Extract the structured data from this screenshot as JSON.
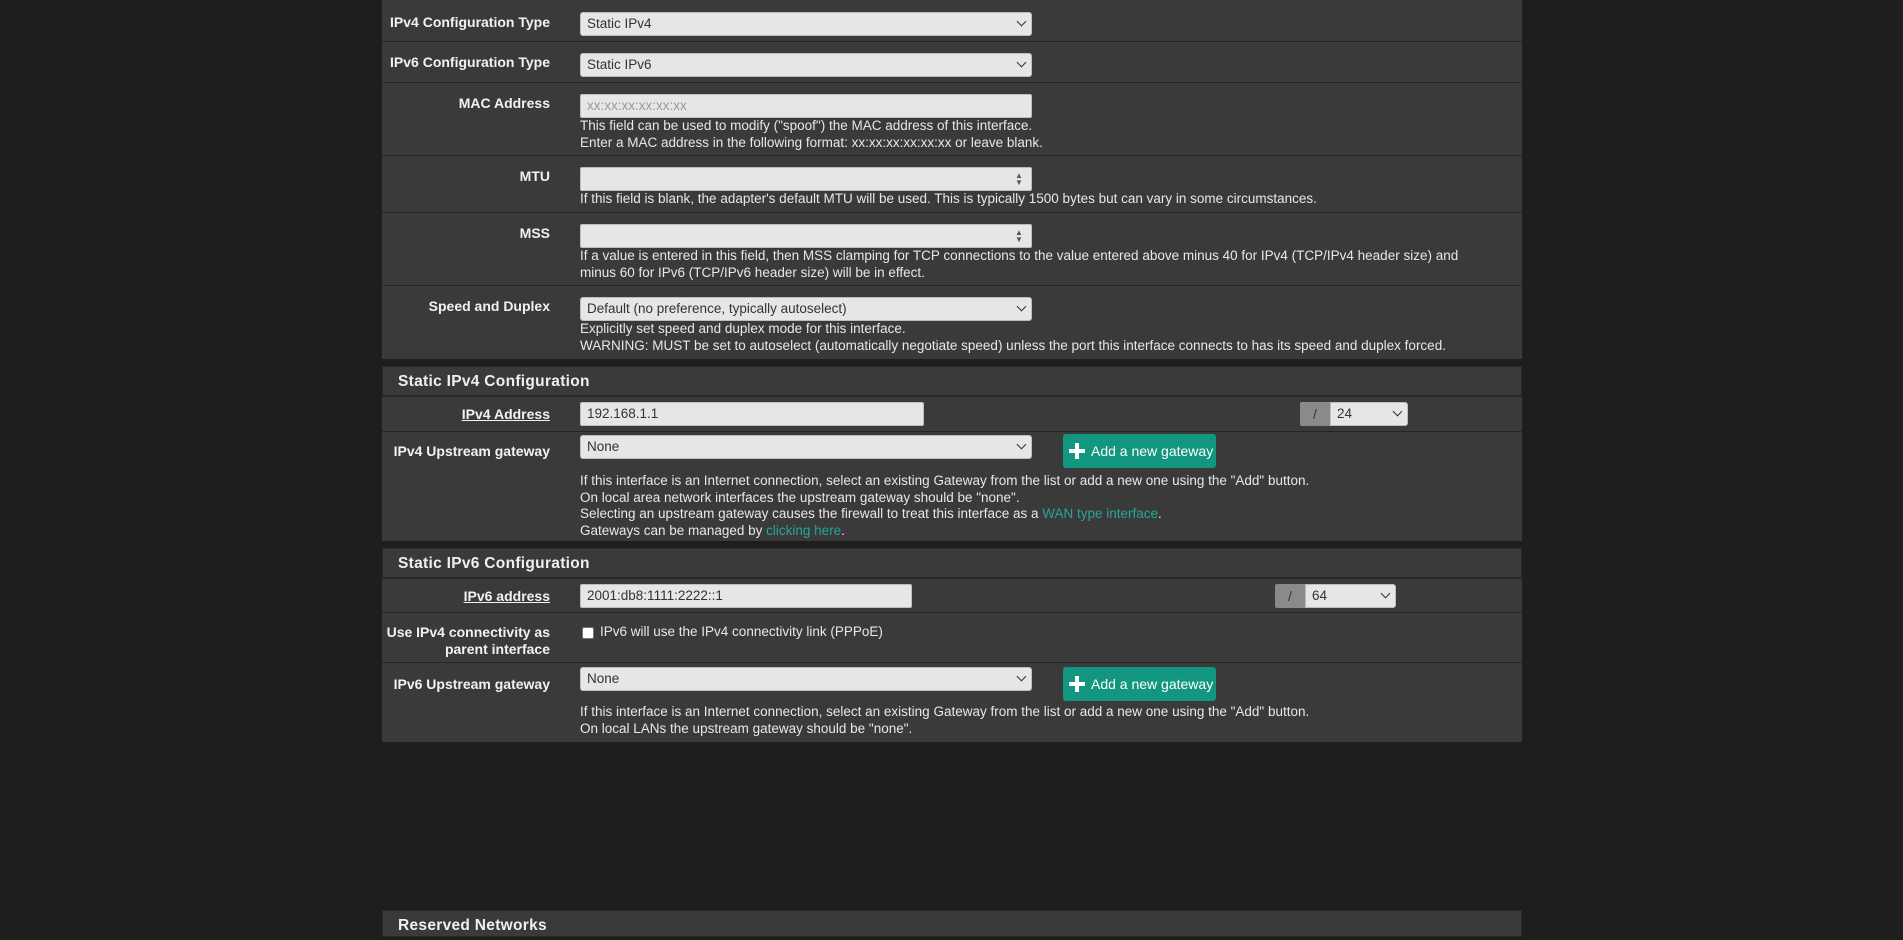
{
  "general": {
    "ipv4_type": {
      "label": "IPv4 Configuration Type",
      "value": "Static IPv4"
    },
    "ipv6_type": {
      "label": "IPv6 Configuration Type",
      "value": "Static IPv6"
    },
    "mac": {
      "label": "MAC Address",
      "placeholder": "xx:xx:xx:xx:xx:xx",
      "help1": "This field can be used to modify (\"spoof\") the MAC address of this interface.",
      "help2": "Enter a MAC address in the following format: xx:xx:xx:xx:xx:xx or leave blank."
    },
    "mtu": {
      "label": "MTU",
      "help1": "If this field is blank, the adapter's default MTU will be used. This is typically 1500 bytes but can vary in some circumstances."
    },
    "mss": {
      "label": "MSS",
      "help1": "If a value is entered in this field, then MSS clamping for TCP connections to the value entered above minus 40 for IPv4 (TCP/IPv4 header size) and",
      "help2": "minus 60 for IPv6 (TCP/IPv6 header size) will be in effect."
    },
    "speed": {
      "label": "Speed and Duplex",
      "value": "Default (no preference, typically autoselect)",
      "help1": "Explicitly set speed and duplex mode for this interface.",
      "help2": "WARNING: MUST be set to autoselect (automatically negotiate speed) unless the port this interface connects to has its speed and duplex forced."
    }
  },
  "static_ipv4": {
    "title": "Static IPv4 Configuration",
    "address_label": "IPv4 Address",
    "address_value": "192.168.1.1",
    "slash": "/",
    "cidr": "24",
    "gateway_label": "IPv4 Upstream gateway",
    "gateway_value": "None",
    "add_gateway": "Add a new gateway",
    "help1": "If this interface is an Internet connection, select an existing Gateway from the list or add a new one using the \"Add\" button.",
    "help2": "On local area network interfaces the upstream gateway should be \"none\".",
    "help3_pre": "Selecting an upstream gateway causes the firewall to treat this interface as a ",
    "help3_link": "WAN type interface",
    "help3_post": ".",
    "help4_pre": "Gateways can be managed by ",
    "help4_link": "clicking here",
    "help4_post": "."
  },
  "static_ipv6": {
    "title": "Static IPv6 Configuration",
    "address_label": "IPv6 address",
    "address_value": "2001:db8:1111:2222::1",
    "slash": "/",
    "prefix": "64",
    "parent_label_1": "Use IPv4 connectivity as",
    "parent_label_2": "parent interface",
    "parent_checkbox_label": "IPv6 will use the IPv4 connectivity link (PPPoE)",
    "gateway_label": "IPv6 Upstream gateway",
    "gateway_value": "None",
    "add_gateway": "Add a new gateway",
    "help1": "If this interface is an Internet connection, select an existing Gateway from the list or add a new one using the \"Add\" button.",
    "help2": "On local LANs the upstream gateway should be \"none\"."
  },
  "reserved": {
    "title": "Reserved Networks"
  },
  "colors": {
    "background": "#1e1e1e",
    "panel": "#3a3a3a",
    "accent": "#13967f",
    "link": "#26a69a"
  }
}
